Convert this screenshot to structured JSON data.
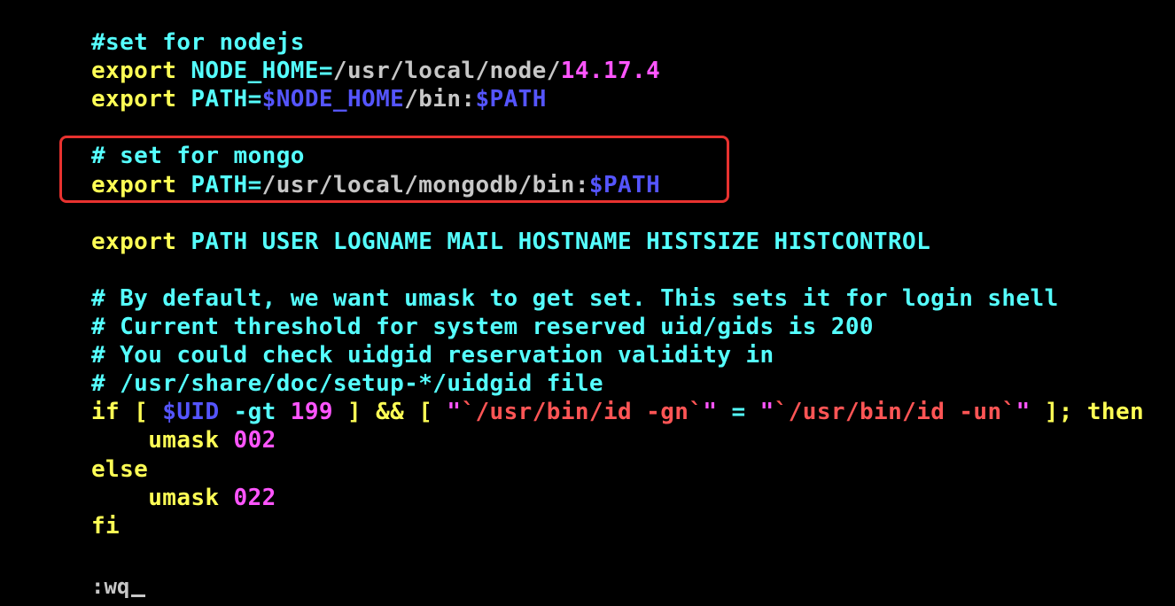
{
  "editor": {
    "lines": [
      [
        {
          "t": "#set for nodejs",
          "c": "c"
        }
      ],
      [
        {
          "t": "export ",
          "c": "y"
        },
        {
          "t": "NODE_HOME=",
          "c": "c"
        },
        {
          "t": "/usr/local/node/",
          "c": "w"
        },
        {
          "t": "14.17.4",
          "c": "m"
        }
      ],
      [
        {
          "t": "export ",
          "c": "y"
        },
        {
          "t": "PATH=",
          "c": "c"
        },
        {
          "t": "$NODE_HOME",
          "c": "b"
        },
        {
          "t": "/bin:",
          "c": "w"
        },
        {
          "t": "$PATH",
          "c": "b"
        }
      ],
      [],
      [
        {
          "t": "# set for mongo",
          "c": "c"
        }
      ],
      [
        {
          "t": "export ",
          "c": "y"
        },
        {
          "t": "PATH=",
          "c": "c"
        },
        {
          "t": "/usr/local/mongodb/bin:",
          "c": "w"
        },
        {
          "t": "$PATH",
          "c": "b"
        }
      ],
      [],
      [
        {
          "t": "export ",
          "c": "y"
        },
        {
          "t": "PATH USER LOGNAME MAIL HOSTNAME HISTSIZE HISTCONTROL",
          "c": "c"
        }
      ],
      [],
      [
        {
          "t": "# By default, we want umask to get set. This sets it for login shell",
          "c": "c"
        }
      ],
      [
        {
          "t": "# Current threshold for system reserved uid/gids is 200",
          "c": "c"
        }
      ],
      [
        {
          "t": "# You could check uidgid reservation validity in",
          "c": "c"
        }
      ],
      [
        {
          "t": "# /usr/share/doc/setup-*/uidgid file",
          "c": "c"
        }
      ],
      [
        {
          "t": "if [ ",
          "c": "y"
        },
        {
          "t": "$UID",
          "c": "b"
        },
        {
          "t": " -gt ",
          "c": "c"
        },
        {
          "t": "199",
          "c": "m"
        },
        {
          "t": " ] && [ ",
          "c": "y"
        },
        {
          "t": "\"",
          "c": "m"
        },
        {
          "t": "`/usr/bin/id -gn`",
          "c": "r"
        },
        {
          "t": "\"",
          "c": "m"
        },
        {
          "t": " = ",
          "c": "c"
        },
        {
          "t": "\"",
          "c": "m"
        },
        {
          "t": "`/usr/bin/id -un`",
          "c": "r"
        },
        {
          "t": "\"",
          "c": "m"
        },
        {
          "t": " ]; then",
          "c": "y"
        }
      ],
      [
        {
          "t": "    umask ",
          "c": "y"
        },
        {
          "t": "002",
          "c": "m"
        }
      ],
      [
        {
          "t": "else",
          "c": "y"
        }
      ],
      [
        {
          "t": "    umask ",
          "c": "y"
        },
        {
          "t": "022",
          "c": "m"
        }
      ],
      [
        {
          "t": "fi",
          "c": "y"
        }
      ]
    ],
    "command_line": ":wq"
  },
  "colors": {
    "background": "#000000",
    "yellow": "#ffff55",
    "cyan": "#55ffff",
    "white": "#c7c7c7",
    "magenta": "#ff55ff",
    "blue": "#5555ff",
    "red": "#ff5555",
    "highlight_border": "#e8322f"
  }
}
